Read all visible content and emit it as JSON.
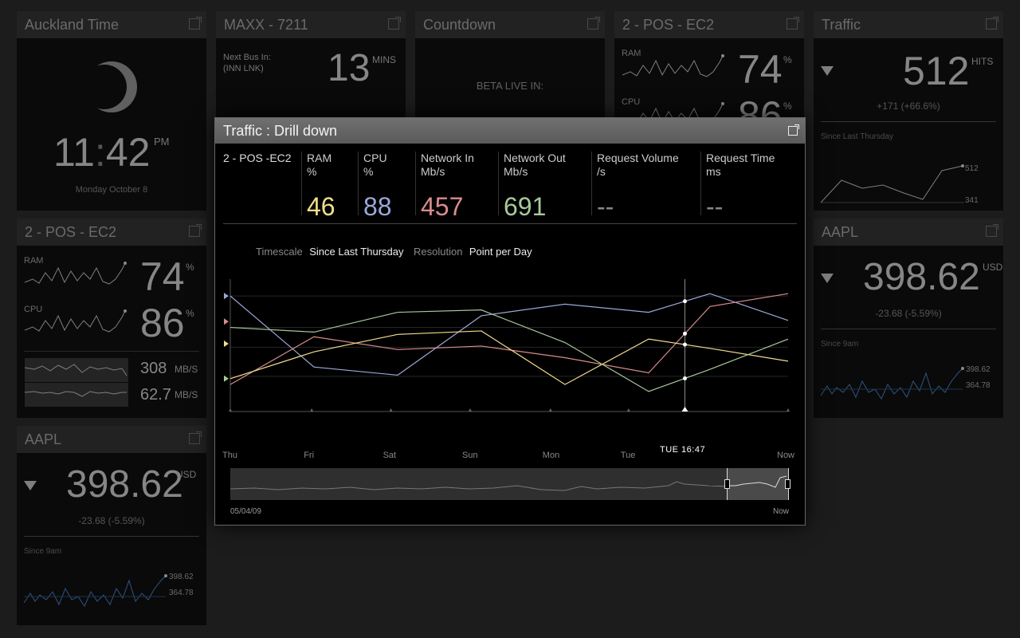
{
  "panels": {
    "auckland": {
      "title": "Auckland Time",
      "time_h": "11",
      "time_m": "42",
      "ampm": "PM",
      "date": "Monday October 8"
    },
    "maxx": {
      "title": "MAXX - 7211",
      "next_bus_label": "Next Bus In:",
      "next_bus_sub": "(INN LNK)",
      "value": "13",
      "unit": "MINS"
    },
    "countdown": {
      "title": "Countdown",
      "text": "BETA LIVE IN:"
    },
    "pos_top": {
      "title": "2 - POS - EC2",
      "ram_label": "RAM",
      "ram_value": "74",
      "cpu_label": "CPU",
      "cpu_value": "86",
      "pct": "%"
    },
    "traffic": {
      "title": "Traffic",
      "value": "512",
      "unit": "HITS",
      "change": "+171 (+66.6%)",
      "since": "Since Last Thursday",
      "max": "512",
      "min": "341"
    },
    "pos_left": {
      "title": "2 - POS - EC2",
      "ram_label": "RAM",
      "ram_value": "74",
      "cpu_label": "CPU",
      "cpu_value": "86",
      "pct": "%",
      "net1": "308",
      "net1_unit": "MB/S",
      "net2": "62.7",
      "net2_unit": "MB/S"
    },
    "aapl_right": {
      "title": "AAPL",
      "value": "398.62",
      "unit": "USD",
      "change": "-23.68 (-5.59%)",
      "since": "Since 9am",
      "hi": "398.62",
      "lo": "364.78"
    },
    "aapl_left": {
      "title": "AAPL",
      "value": "398.62",
      "unit": "USD",
      "change": "-23.68 (-5.59%)",
      "since": "Since 9am",
      "hi": "398.62",
      "lo": "364.78"
    }
  },
  "modal": {
    "title": "Traffic : Drill down",
    "server": "2 - POS -EC2",
    "metrics": [
      {
        "label": "RAM",
        "unit": "%",
        "value": "46",
        "color": "#f2dd8c"
      },
      {
        "label": "CPU",
        "unit": "%",
        "value": "88",
        "color": "#9aa8d8"
      },
      {
        "label": "Network In",
        "unit": "Mb/s",
        "value": "457",
        "color": "#d98c8c"
      },
      {
        "label": "Network Out",
        "unit": "Mb/s",
        "value": "691",
        "color": "#a7c99a"
      },
      {
        "label": "Request Volume",
        "unit": "/s",
        "value": "--",
        "color": "#888888"
      },
      {
        "label": "Request Time",
        "unit": "ms",
        "value": "--",
        "color": "#888888"
      }
    ],
    "timescale_label": "Timescale",
    "timescale_value": "Since Last Thursday",
    "resolution_label": "Resolution",
    "resolution_value": "Point per Day",
    "cursor_label": "TUE 16:47",
    "overview_start": "05/04/09",
    "overview_end": "Now"
  },
  "chart_data": {
    "type": "line",
    "categories": [
      "Thu",
      "Fri",
      "Sat",
      "Sun",
      "Mon",
      "Tue",
      "Now"
    ],
    "series": [
      {
        "color": "#9aa8d8",
        "values": [
          0.91,
          0.3,
          0.23,
          0.74,
          0.84,
          0.77,
          0.93,
          0.7
        ]
      },
      {
        "color": "#d98c8c",
        "values": [
          0.15,
          0.56,
          0.45,
          0.48,
          0.38,
          0.25,
          0.82,
          0.93
        ]
      },
      {
        "color": "#f2dd8c",
        "values": [
          0.2,
          0.43,
          0.58,
          0.61,
          0.15,
          0.54,
          0.46,
          0.35
        ]
      },
      {
        "color": "#a7c99a",
        "values": [
          0.64,
          0.6,
          0.77,
          0.79,
          0.51,
          0.09,
          0.28,
          0.54
        ]
      }
    ],
    "x_positions": [
      0,
      0.15,
      0.3,
      0.45,
      0.6,
      0.75,
      0.86,
      1.0
    ],
    "cursor_x": 0.815,
    "grid": true
  }
}
